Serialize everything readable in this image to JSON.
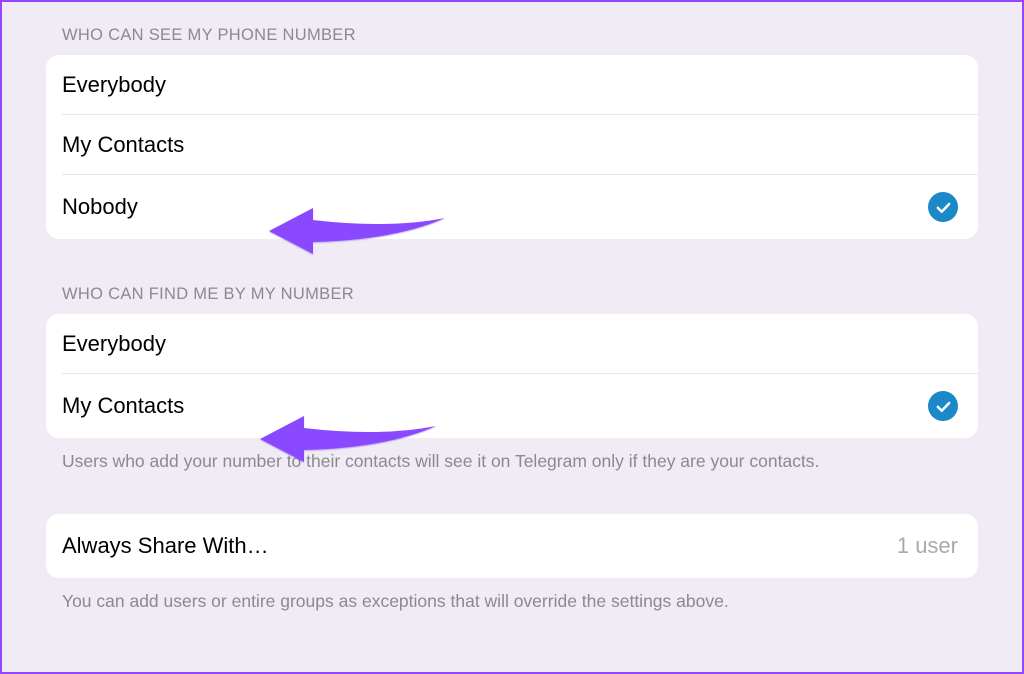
{
  "section1": {
    "header": "WHO CAN SEE MY PHONE NUMBER",
    "options": [
      {
        "label": "Everybody",
        "selected": false
      },
      {
        "label": "My Contacts",
        "selected": false
      },
      {
        "label": "Nobody",
        "selected": true
      }
    ]
  },
  "section2": {
    "header": "WHO CAN FIND ME BY MY NUMBER",
    "options": [
      {
        "label": "Everybody",
        "selected": false
      },
      {
        "label": "My Contacts",
        "selected": true
      }
    ],
    "footer": "Users who add your number to their contacts will see it on Telegram only if they are your contacts."
  },
  "section3": {
    "label": "Always Share With…",
    "value": "1 user",
    "footer": "You can add users or entire groups as exceptions that will override the settings above."
  }
}
